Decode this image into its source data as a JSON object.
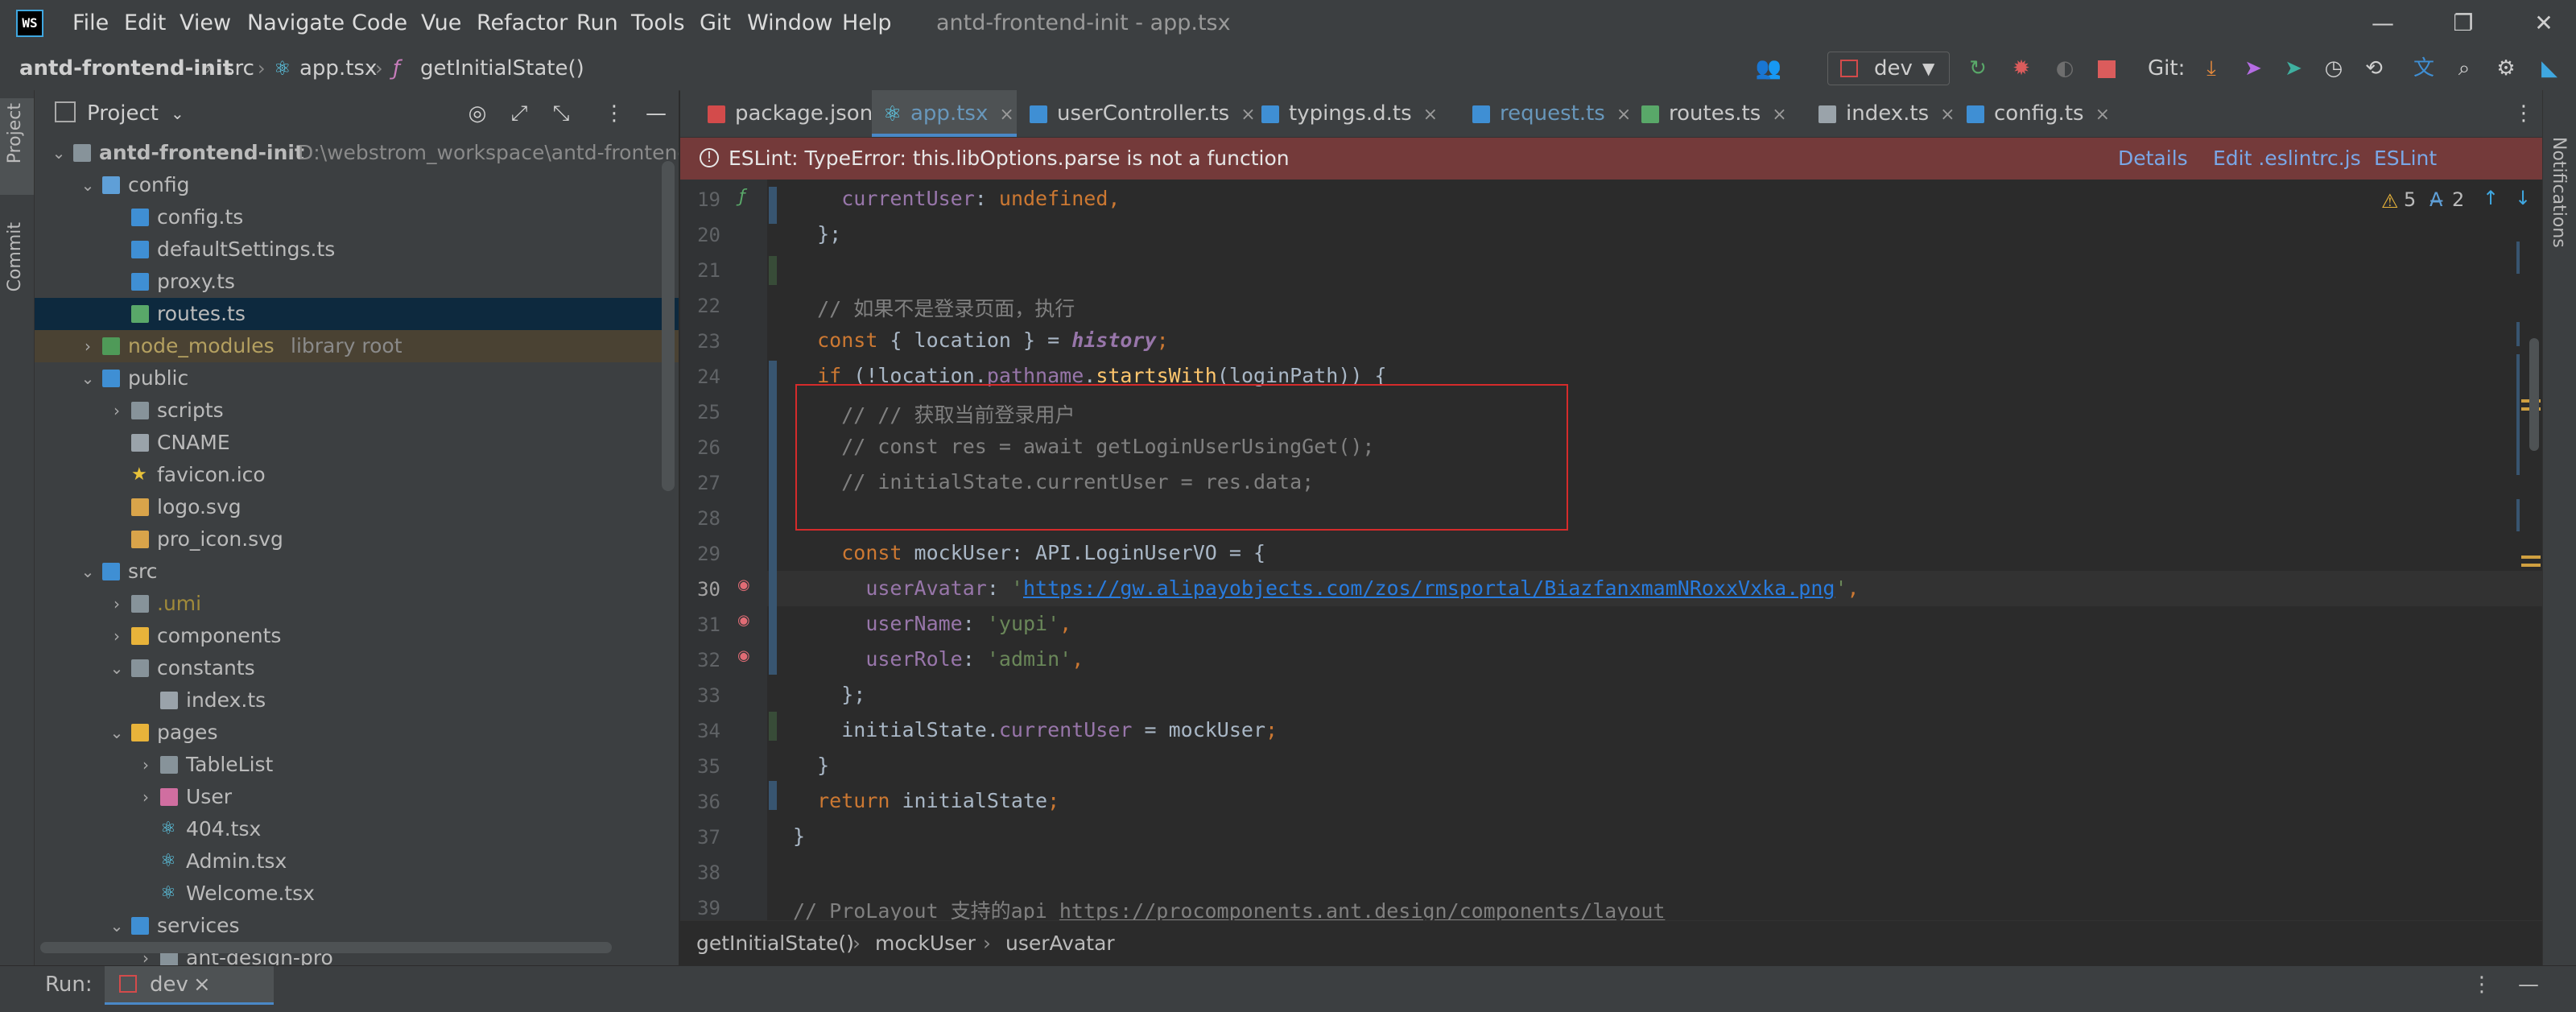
{
  "menu": [
    "File",
    "Edit",
    "View",
    "Navigate",
    "Code",
    "Vue",
    "Refactor",
    "Run",
    "Tools",
    "Git",
    "Window",
    "Help"
  ],
  "window_title": "antd-frontend-init - app.tsx",
  "window_controls": {
    "minimize": "—",
    "maximize": "❐",
    "close": "✕"
  },
  "breadcrumb": {
    "project": "antd-frontend-init",
    "folder": "src",
    "file": "app.tsx",
    "symbol": "getInitialState()"
  },
  "toolbar": {
    "run_config": "dev",
    "git_label": "Git:"
  },
  "left_tabs": {
    "project": "Project",
    "commit": "Commit"
  },
  "right_tabs": {
    "notifications": "Notifications"
  },
  "project_panel": {
    "title": "Project",
    "tree": [
      {
        "name": "antd-frontend-init",
        "hint": "D:\\webstrom_workspace\\antd-frontend-in",
        "depth": 0,
        "arrow": "⌄",
        "icon": "folder",
        "bold": true
      },
      {
        "name": "config",
        "depth": 1,
        "arrow": "⌄",
        "icon": "folder-config"
      },
      {
        "name": "config.ts",
        "depth": 2,
        "arrow": "",
        "icon": "ts"
      },
      {
        "name": "defaultSettings.ts",
        "depth": 2,
        "arrow": "",
        "icon": "ts"
      },
      {
        "name": "proxy.ts",
        "depth": 2,
        "arrow": "",
        "icon": "ts"
      },
      {
        "name": "routes.ts",
        "depth": 2,
        "arrow": "",
        "icon": "routes",
        "selected": true
      },
      {
        "name": "node_modules",
        "hint": "library root",
        "depth": 1,
        "arrow": "›",
        "icon": "folder-lib",
        "excluded": true
      },
      {
        "name": "public",
        "depth": 1,
        "arrow": "⌄",
        "icon": "folder-public"
      },
      {
        "name": "scripts",
        "depth": 2,
        "arrow": "›",
        "icon": "folder"
      },
      {
        "name": "CNAME",
        "depth": 2,
        "arrow": "",
        "icon": "file"
      },
      {
        "name": "favicon.ico",
        "depth": 2,
        "arrow": "",
        "icon": "star"
      },
      {
        "name": "logo.svg",
        "depth": 2,
        "arrow": "",
        "icon": "svg"
      },
      {
        "name": "pro_icon.svg",
        "depth": 2,
        "arrow": "",
        "icon": "svg"
      },
      {
        "name": "src",
        "depth": 1,
        "arrow": "⌄",
        "icon": "folder-src"
      },
      {
        "name": ".umi",
        "depth": 2,
        "arrow": "›",
        "icon": "folder",
        "dim": true
      },
      {
        "name": "components",
        "depth": 2,
        "arrow": "›",
        "icon": "folder-yellow"
      },
      {
        "name": "constants",
        "depth": 2,
        "arrow": "⌄",
        "icon": "folder"
      },
      {
        "name": "index.ts",
        "depth": 3,
        "arrow": "",
        "icon": "list"
      },
      {
        "name": "pages",
        "depth": 2,
        "arrow": "⌄",
        "icon": "folder-yellow"
      },
      {
        "name": "TableList",
        "depth": 3,
        "arrow": "›",
        "icon": "folder"
      },
      {
        "name": "User",
        "depth": 3,
        "arrow": "›",
        "icon": "folder-pink"
      },
      {
        "name": "404.tsx",
        "depth": 3,
        "arrow": "",
        "icon": "react"
      },
      {
        "name": "Admin.tsx",
        "depth": 3,
        "arrow": "",
        "icon": "react"
      },
      {
        "name": "Welcome.tsx",
        "depth": 3,
        "arrow": "",
        "icon": "react"
      },
      {
        "name": "services",
        "depth": 2,
        "arrow": "⌄",
        "icon": "folder-blue"
      },
      {
        "name": "ant-design-pro",
        "depth": 3,
        "arrow": "›",
        "icon": "folder"
      }
    ]
  },
  "tabs": [
    {
      "label": "package.json",
      "icon": "json"
    },
    {
      "label": "app.tsx",
      "icon": "react",
      "active": true
    },
    {
      "label": "userController.ts",
      "icon": "ts"
    },
    {
      "label": "typings.d.ts",
      "icon": "ts"
    },
    {
      "label": "request.ts",
      "icon": "ts",
      "modified": true
    },
    {
      "label": "routes.ts",
      "icon": "routes"
    },
    {
      "label": "index.ts",
      "icon": "list"
    },
    {
      "label": "config.ts",
      "icon": "ts"
    }
  ],
  "tab_close": "×",
  "eslint_banner": {
    "message": "ESLint: TypeError: this.libOptions.parse is not a function",
    "links": [
      "Details",
      "Edit .eslintrc.js",
      "ESLint settings..."
    ]
  },
  "inspections": {
    "warnings": "5",
    "typos": "2"
  },
  "code": {
    "lines": [
      19,
      20,
      21,
      22,
      23,
      24,
      25,
      26,
      27,
      28,
      29,
      30,
      31,
      32,
      33,
      34,
      35,
      36,
      37,
      38,
      39
    ],
    "current_line": 30
  },
  "editor_breadcrumb": [
    "getInitialState()",
    "mockUser",
    "userAvatar"
  ],
  "run_bar": {
    "label": "Run:",
    "tab": "dev",
    "close": "×"
  }
}
